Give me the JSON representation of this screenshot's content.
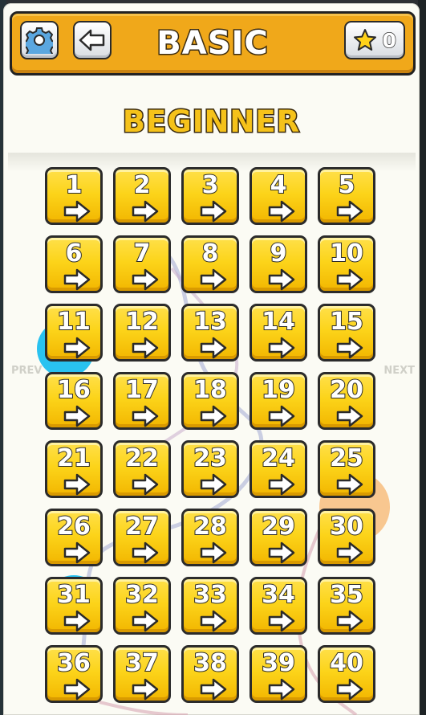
{
  "header": {
    "title": "BASIC",
    "star_count": "0",
    "colors": {
      "bar": "#f0a81a",
      "tile": "#fcd41a"
    }
  },
  "subtitle": "BEGINNER",
  "nav": {
    "prev": "PREV",
    "next": "NEXT"
  },
  "levels": [
    "1",
    "2",
    "3",
    "4",
    "5",
    "6",
    "7",
    "8",
    "9",
    "10",
    "11",
    "12",
    "13",
    "14",
    "15",
    "16",
    "17",
    "18",
    "19",
    "20",
    "21",
    "22",
    "23",
    "24",
    "25",
    "26",
    "27",
    "28",
    "29",
    "30",
    "31",
    "32",
    "33",
    "34",
    "35",
    "36",
    "37",
    "38",
    "39",
    "40"
  ]
}
